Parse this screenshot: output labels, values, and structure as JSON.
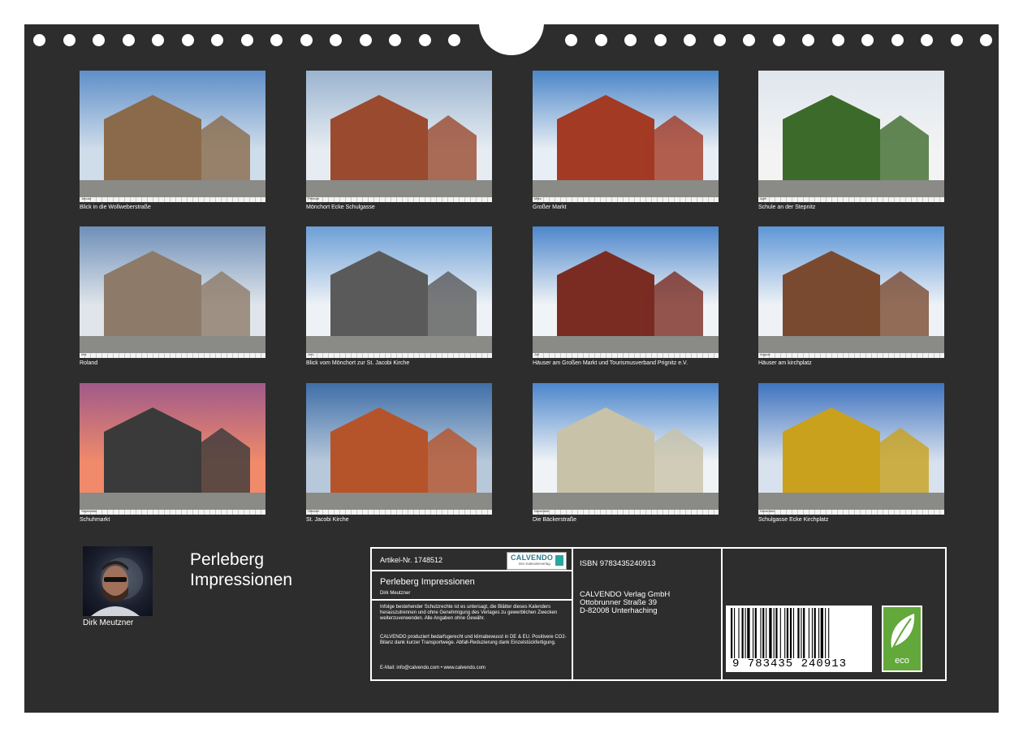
{
  "tiles": [
    {
      "caption": "Blick in die Wollweberstraße",
      "month": "Januar"
    },
    {
      "caption": "Mönchort Ecke Schulgasse",
      "month": "Februar"
    },
    {
      "caption": "Großer Markt",
      "month": "März"
    },
    {
      "caption": "Schule an der Stepnitz",
      "month": "April"
    },
    {
      "caption": "Roland",
      "month": "Mai"
    },
    {
      "caption": "Blick vom Mönchort zur St. Jacobi Kirche",
      "month": "Juni"
    },
    {
      "caption": "Häuser am Großen Markt und Tourismusverband Prignitz e.V.",
      "month": "Juli"
    },
    {
      "caption": "Häuser am kirchplatz",
      "month": "August"
    },
    {
      "caption": "Schuhmarkt",
      "month": "September"
    },
    {
      "caption": "St. Jacobi Kirche",
      "month": "Oktober"
    },
    {
      "caption": "Die Bäckerstraße",
      "month": "November"
    },
    {
      "caption": "Schulgasse Ecke Kirchplatz",
      "month": "Dezember"
    }
  ],
  "author": {
    "name": "Dirk Meutzner"
  },
  "book": {
    "title": "Perleberg Impressionen"
  },
  "info": {
    "artikel": "Artikel-Nr. 1748512",
    "logo_text": "CALVENDO",
    "logo_sub": "Der Kalenderverlag",
    "title": "Perleberg Impressionen",
    "author": "Dirk Meutzner",
    "legal": "Infolge bestehender Schutzrechte ist es untersagt, die Blätter dieses Kalenders herauszutrennen und ohne Genehmigung des Verlages zu gewerblichen Zwecken weiterzuverwenden. Alle Angaben ohne Gewähr.",
    "eco_note": "CALVENDO produziert bedarfsgerecht und klimabewusst in DE & EU. Positivere CO2-Bilanz dank kurzer Transportwege. Abfall-Reduzierung dank Einzelstückfertigung.",
    "contact": "E-Mail: info@calvendo.com • www.calvendo.com",
    "isbn": "ISBN 9783435240913",
    "publisher_line1": "CALVENDO Verlag GmbH",
    "publisher_line2": "Ottobrunner Straße 39",
    "publisher_line3": "D-82008 Unterhaching",
    "barcode_digits": "9 783435 240913",
    "eco_label": "eco"
  },
  "colors": {
    "board": "#2d2d2d",
    "eco_green": "#62a83a",
    "calvendo_teal": "#2c7a8c"
  }
}
